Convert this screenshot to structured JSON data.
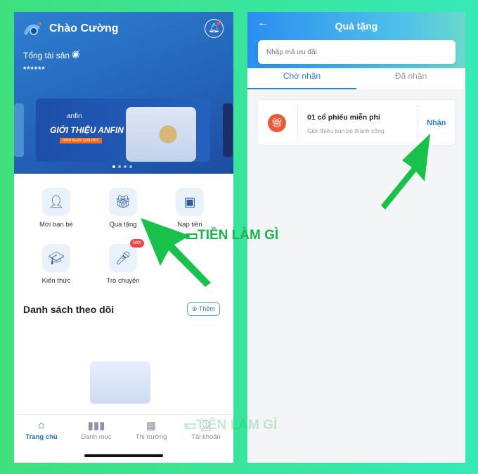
{
  "home": {
    "greeting": "Chào Cường",
    "total_assets_label": "Tổng tài sản",
    "hidden_balance": "******",
    "banner": {
      "brand": "anfin",
      "title": "GIỚI THIỆU ANFIN",
      "subtitle": "RINH NGAY QUÀ HOT"
    },
    "menu": [
      {
        "label": "Mời bạn bè",
        "icon": "invite-friend-icon"
      },
      {
        "label": "Quà tặng",
        "icon": "gift-icon"
      },
      {
        "label": "Nạp tiền",
        "icon": "wallet-icon"
      },
      {
        "label": "Kiến thức",
        "icon": "graduation-cap-icon"
      },
      {
        "label": "Trò chuyện",
        "icon": "microphone-icon",
        "badge": "Mới"
      }
    ],
    "watchlist_title": "Danh sách theo dõi",
    "add_label": "Thêm",
    "tabbar": [
      {
        "label": "Trang chủ",
        "icon": "home-icon",
        "active": true
      },
      {
        "label": "Danh mục",
        "icon": "bar-chart-icon"
      },
      {
        "label": "Thị trường",
        "icon": "grid-icon"
      },
      {
        "label": "Tài khoản",
        "icon": "user-icon"
      }
    ]
  },
  "gifts": {
    "title": "Quà tặng",
    "code_placeholder": "Nhập mã ưu đãi",
    "tabs": [
      {
        "label": "Chờ nhận",
        "active": true
      },
      {
        "label": "Đã nhận"
      }
    ],
    "items": [
      {
        "title": "01 cổ phiếu miễn phí",
        "subtitle": "Giới thiệu bạn bè thành công",
        "action": "Nhận"
      }
    ]
  },
  "watermark": "TIỀN LÀM GÌ",
  "colors": {
    "accent": "#2a7fcf",
    "arrow": "#19c04a",
    "gift": "#e95a3a",
    "badge": "#f04343"
  }
}
